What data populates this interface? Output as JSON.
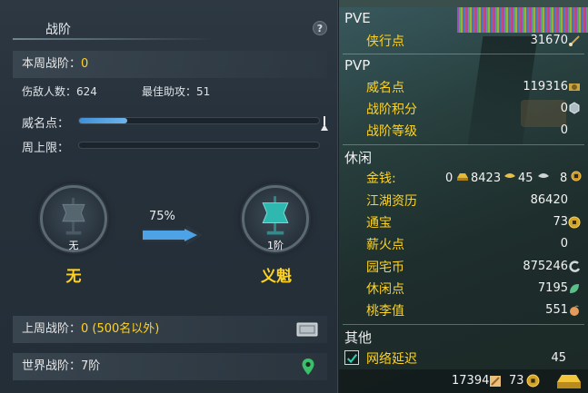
{
  "left": {
    "title": "战阶",
    "help": "?",
    "weekly_rank_label": "本周战阶：",
    "weekly_rank_value": "0",
    "kills_label": "伤敌人数：624",
    "assist_label": "最佳助攻：51",
    "prestige_label": "威名点：",
    "prestige_progress": 0.2,
    "week_cap_label": "周上限：",
    "week_cap_progress": 0,
    "current_rank_small": "无",
    "current_rank_name": "无",
    "next_rank_small": "1阶",
    "next_rank_name": "义魁",
    "progress_pct": "75%",
    "last_rank_label": "上周战阶：",
    "last_rank_value": "0 (500名以外)",
    "world_rank_label": "世界战阶：7阶"
  },
  "right": {
    "pve": {
      "title": "PVE",
      "items": [
        {
          "label": "侠行点",
          "value": "31670",
          "icon": "brush-icon"
        }
      ]
    },
    "pvp": {
      "title": "PVP",
      "items": [
        {
          "label": "威名点",
          "value": "119316",
          "icon": "prestige-icon"
        },
        {
          "label": "战阶积分",
          "value": "0",
          "icon": "rank-points-icon"
        },
        {
          "label": "战阶等级",
          "value": "0"
        }
      ]
    },
    "leisure": {
      "title": "休闲",
      "money_label": "金钱:",
      "money_values": [
        "0",
        "8423",
        "45",
        "8"
      ],
      "items": [
        {
          "label": "江湖资历",
          "value": "86420"
        },
        {
          "label": "通宝",
          "value": "73",
          "icon": "coin-icon"
        },
        {
          "label": "薪火点",
          "value": "0"
        },
        {
          "label": "园宅币",
          "value": "875246",
          "icon": "house-coin-icon"
        },
        {
          "label": "休闲点",
          "value": "7195",
          "icon": "leaf-icon"
        },
        {
          "label": "桃李值",
          "value": "551",
          "icon": "peach-icon"
        }
      ]
    },
    "other": {
      "title": "其他",
      "network_label": "网络延迟",
      "network_value": "45",
      "network_checked": true
    },
    "bottom": {
      "value1": "17394",
      "value2": "73"
    }
  }
}
